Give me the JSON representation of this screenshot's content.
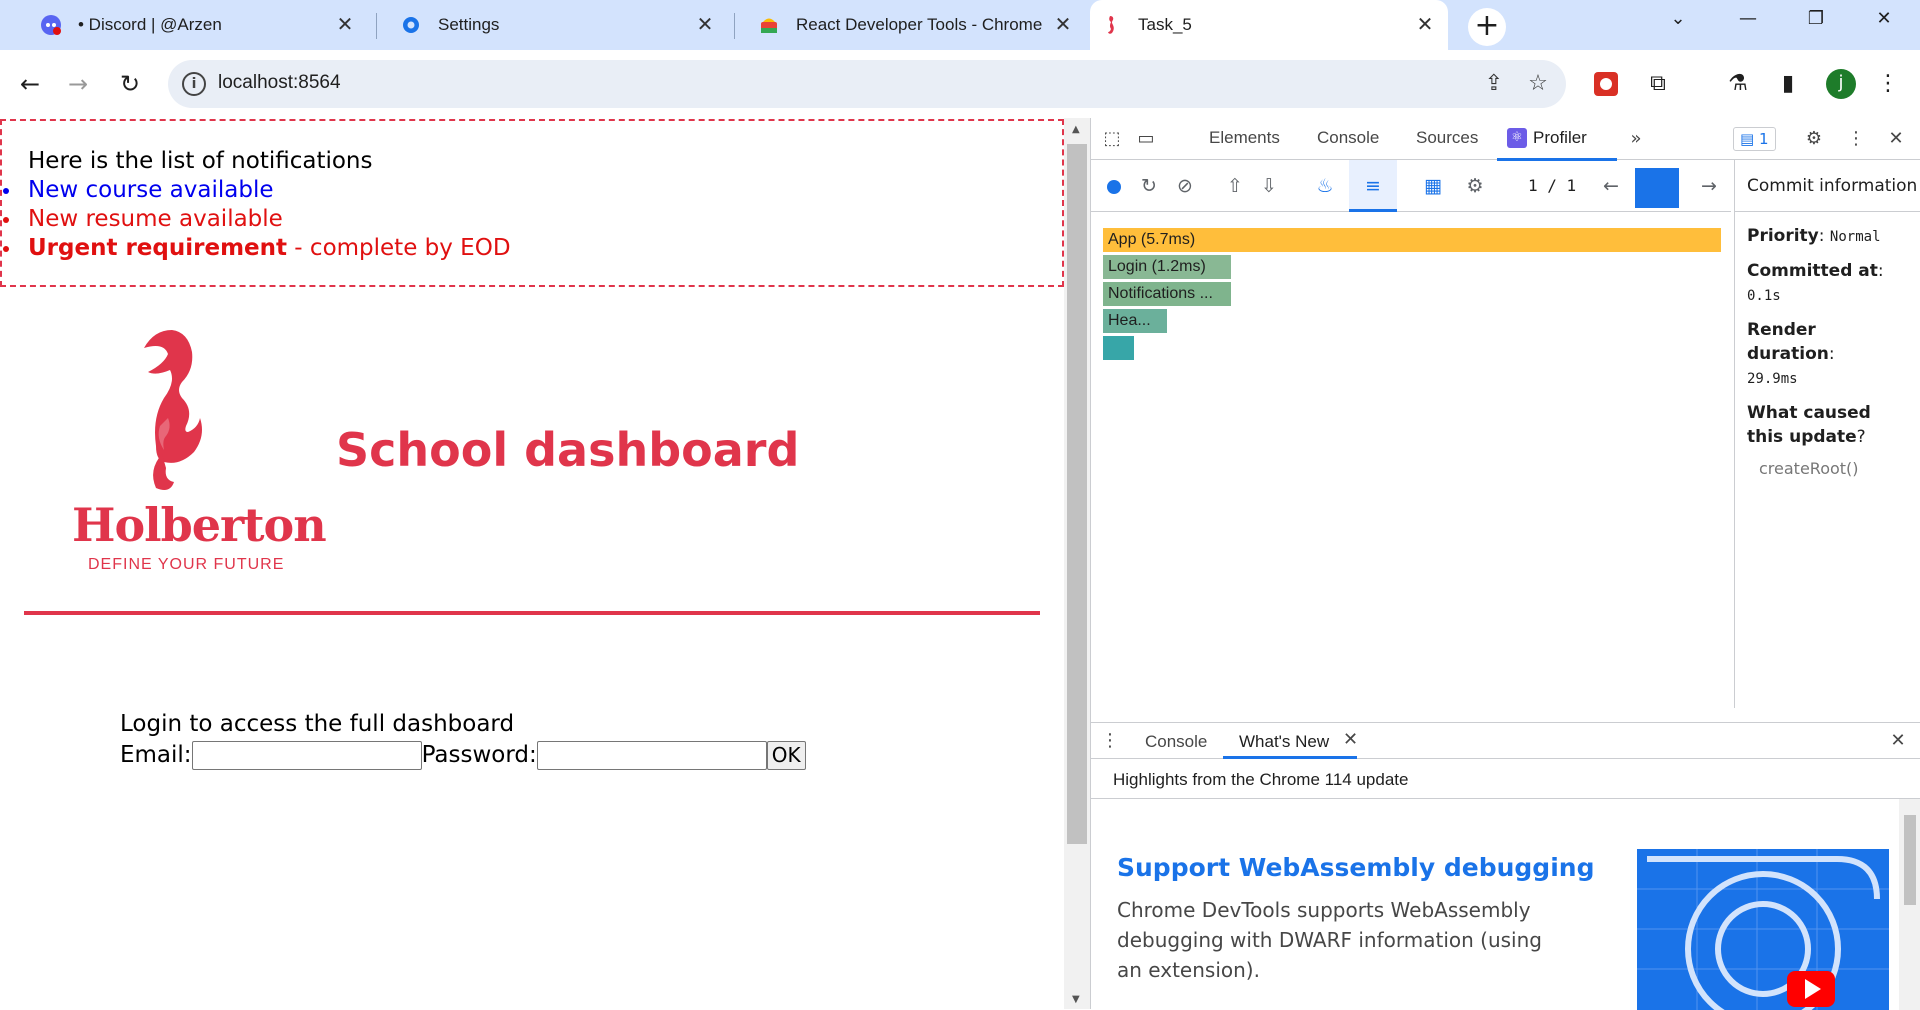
{
  "tabs": [
    {
      "title": "• Discord | @Arzen",
      "icon": "discord-icon"
    },
    {
      "title": "Settings",
      "icon": "gear-icon"
    },
    {
      "title": "React Developer Tools - Chrome",
      "icon": "chrome-webstore-icon"
    },
    {
      "title": "Task_5",
      "icon": "holberton-seahorse-icon"
    }
  ],
  "toolbar": {
    "url": "localhost:8564"
  },
  "profile": {
    "initial": "j",
    "color": "#1e7c2a"
  },
  "page": {
    "notifications": {
      "intro": "Here is the list of notifications",
      "items": [
        {
          "text": "New course available",
          "type": "default"
        },
        {
          "text": "New resume available",
          "type": "urgent"
        },
        {
          "bold": "Urgent requirement",
          "rest": " - complete by EOD",
          "type": "urgent"
        }
      ]
    },
    "logo": {
      "word": "Holberton",
      "tagline": "DEFINE YOUR FUTURE"
    },
    "title": "School dashboard",
    "login": {
      "prompt": "Login to access the full dashboard",
      "email_label": "Email:",
      "password_label": "Password:",
      "ok_label": "OK"
    },
    "brand_color": "#e0354b"
  },
  "devtools": {
    "tabs": [
      "Elements",
      "Console",
      "Sources",
      "Profiler"
    ],
    "active_tab": "Profiler",
    "issues_count": "1",
    "commit_count": "1 / 1",
    "commit_info_label": "Commit information",
    "side": {
      "priority_label": "Priority",
      "priority_value": "Normal",
      "committed_label": "Committed at",
      "committed_value": "0.1s",
      "render_label": "Render duration",
      "render_value": "29.9ms",
      "cause_label": "What caused this update",
      "cause_value": "createRoot()"
    },
    "flame": [
      {
        "label": "App (5.7ms)",
        "color": "#ffbe3b"
      },
      {
        "label": "Login (1.2ms)",
        "color": "#89b894"
      },
      {
        "label": "Notifications ...",
        "color": "#7fb48d"
      },
      {
        "label": "Hea...",
        "color": "#6bb09b"
      },
      {
        "label": "",
        "color": "#37a6a8"
      }
    ],
    "drawer": {
      "tabs": [
        "Console",
        "What's New"
      ],
      "active_tab": "What's New",
      "headline": "Highlights from the Chrome 114 update",
      "feature_title": "Support WebAssembly debugging",
      "feature_desc": "Chrome DevTools supports WebAssembly debugging with DWARF information (using an extension)."
    }
  }
}
